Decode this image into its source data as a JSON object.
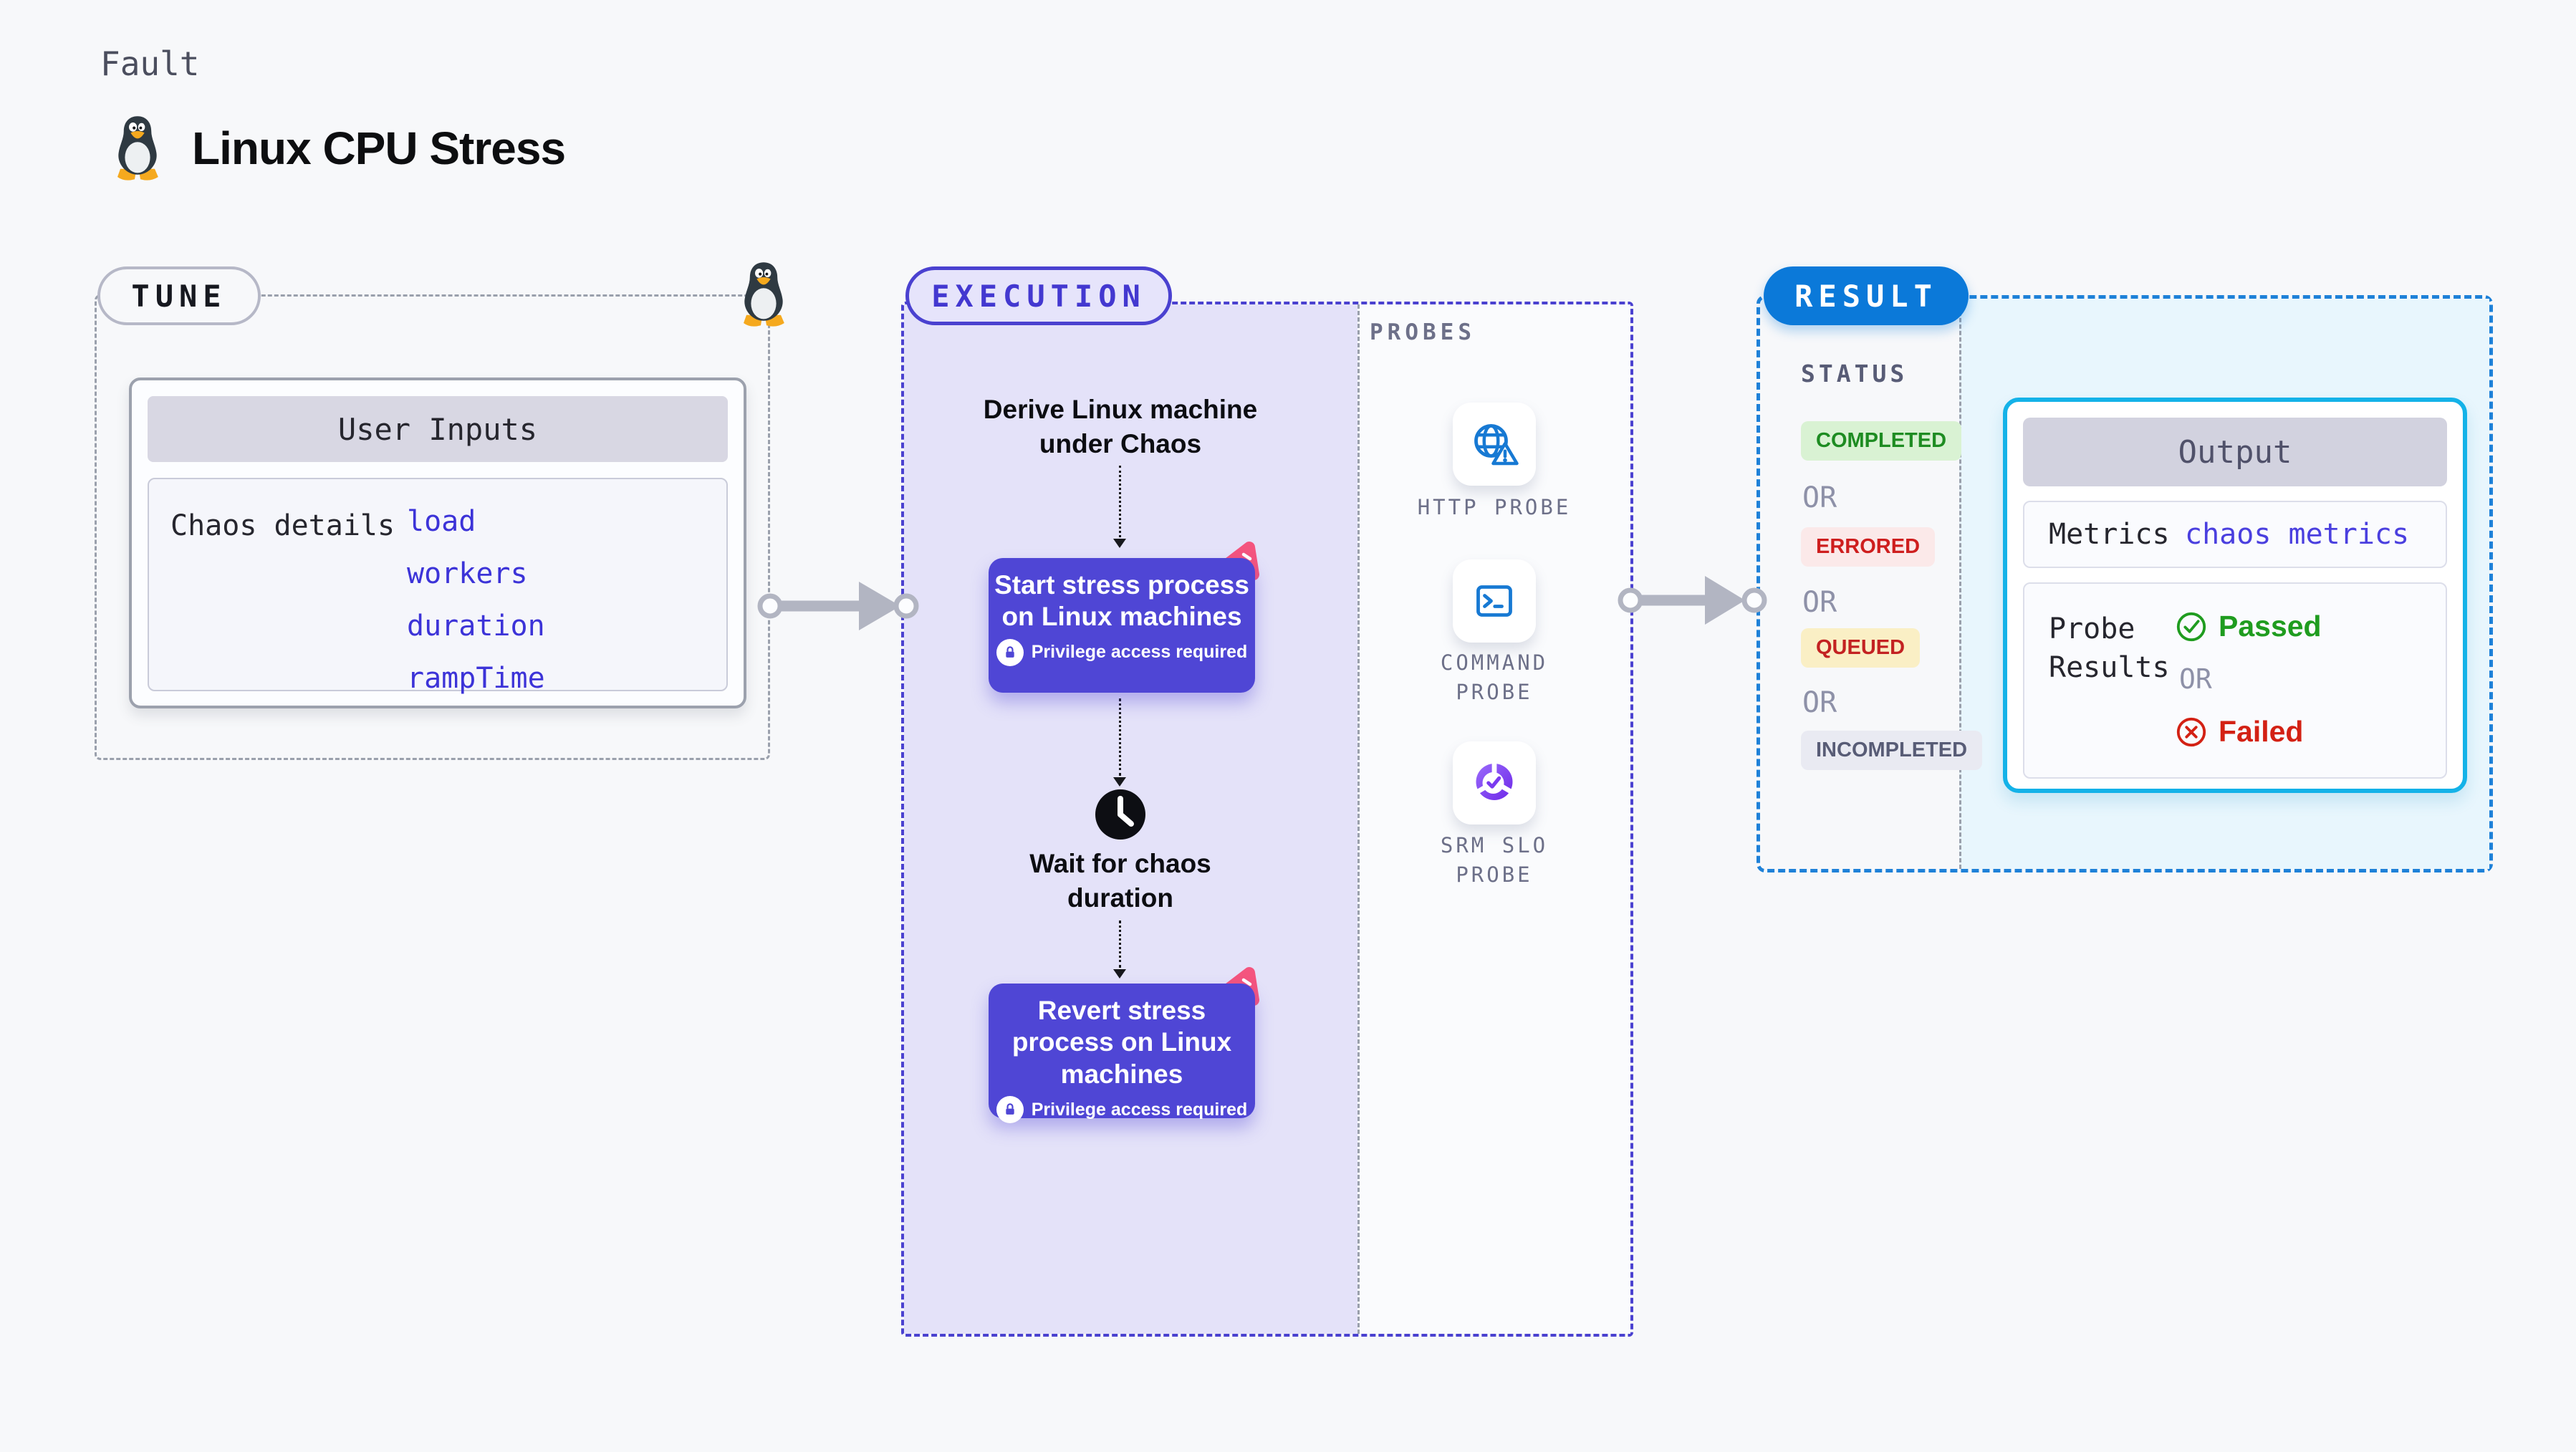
{
  "page": {
    "kicker": "Fault",
    "title": "Linux CPU Stress"
  },
  "tune": {
    "badge": "TUNE",
    "card_header": "User Inputs",
    "row_label": "Chaos details",
    "inputs": [
      "load",
      "workers",
      "duration",
      "rampTime"
    ]
  },
  "execution": {
    "badge": "EXECUTION",
    "derive_text": "Derive Linux machine under Chaos",
    "start_step": {
      "title": "Start stress process on Linux machines",
      "note": "Privilege access required"
    },
    "wait_text": "Wait for chaos duration",
    "revert_step": {
      "title": "Revert stress process on Linux machines",
      "note": "Privilege access required"
    }
  },
  "probes": {
    "section_label": "PROBES",
    "items": [
      {
        "label": "HTTP PROBE",
        "icon": "globe-alert-icon"
      },
      {
        "label": "COMMAND PROBE",
        "icon": "terminal-icon"
      },
      {
        "label": "SRM SLO PROBE",
        "icon": "slo-pie-check-icon"
      }
    ]
  },
  "result": {
    "badge": "RESULT",
    "status_label": "STATUS",
    "or_label": "OR",
    "statuses": [
      {
        "label": "COMPLETED",
        "kind": "success"
      },
      {
        "label": "ERRORED",
        "kind": "error"
      },
      {
        "label": "QUEUED",
        "kind": "warning"
      },
      {
        "label": "INCOMPLETED",
        "kind": "neutral"
      }
    ],
    "output": {
      "header": "Output",
      "metrics_label": "Metrics",
      "metrics_value": "chaos metrics",
      "probe_results_label": "Probe Results",
      "passed_label": "Passed",
      "or_label": "OR",
      "failed_label": "Failed"
    }
  },
  "colors": {
    "page_bg": "#f7f8fa",
    "indigo_accent": "#4f46d5",
    "execution_panel_bg": "#e4e2f9",
    "result_badge_blue": "#0b79d9",
    "result_border_blue": "#1e81d8",
    "output_border_cyan": "#14b2e8",
    "result_panel_cyan": "#e8f6fd",
    "probe_icon_blue": "#1779d3",
    "srm_purple": "#7b3bf0",
    "success_green": "#1f9c1f",
    "error_red": "#d32114",
    "link_indigo": "#3c33d8",
    "arrow_gray": "#b2b5c2",
    "pink_chaos": "#f4547e"
  }
}
